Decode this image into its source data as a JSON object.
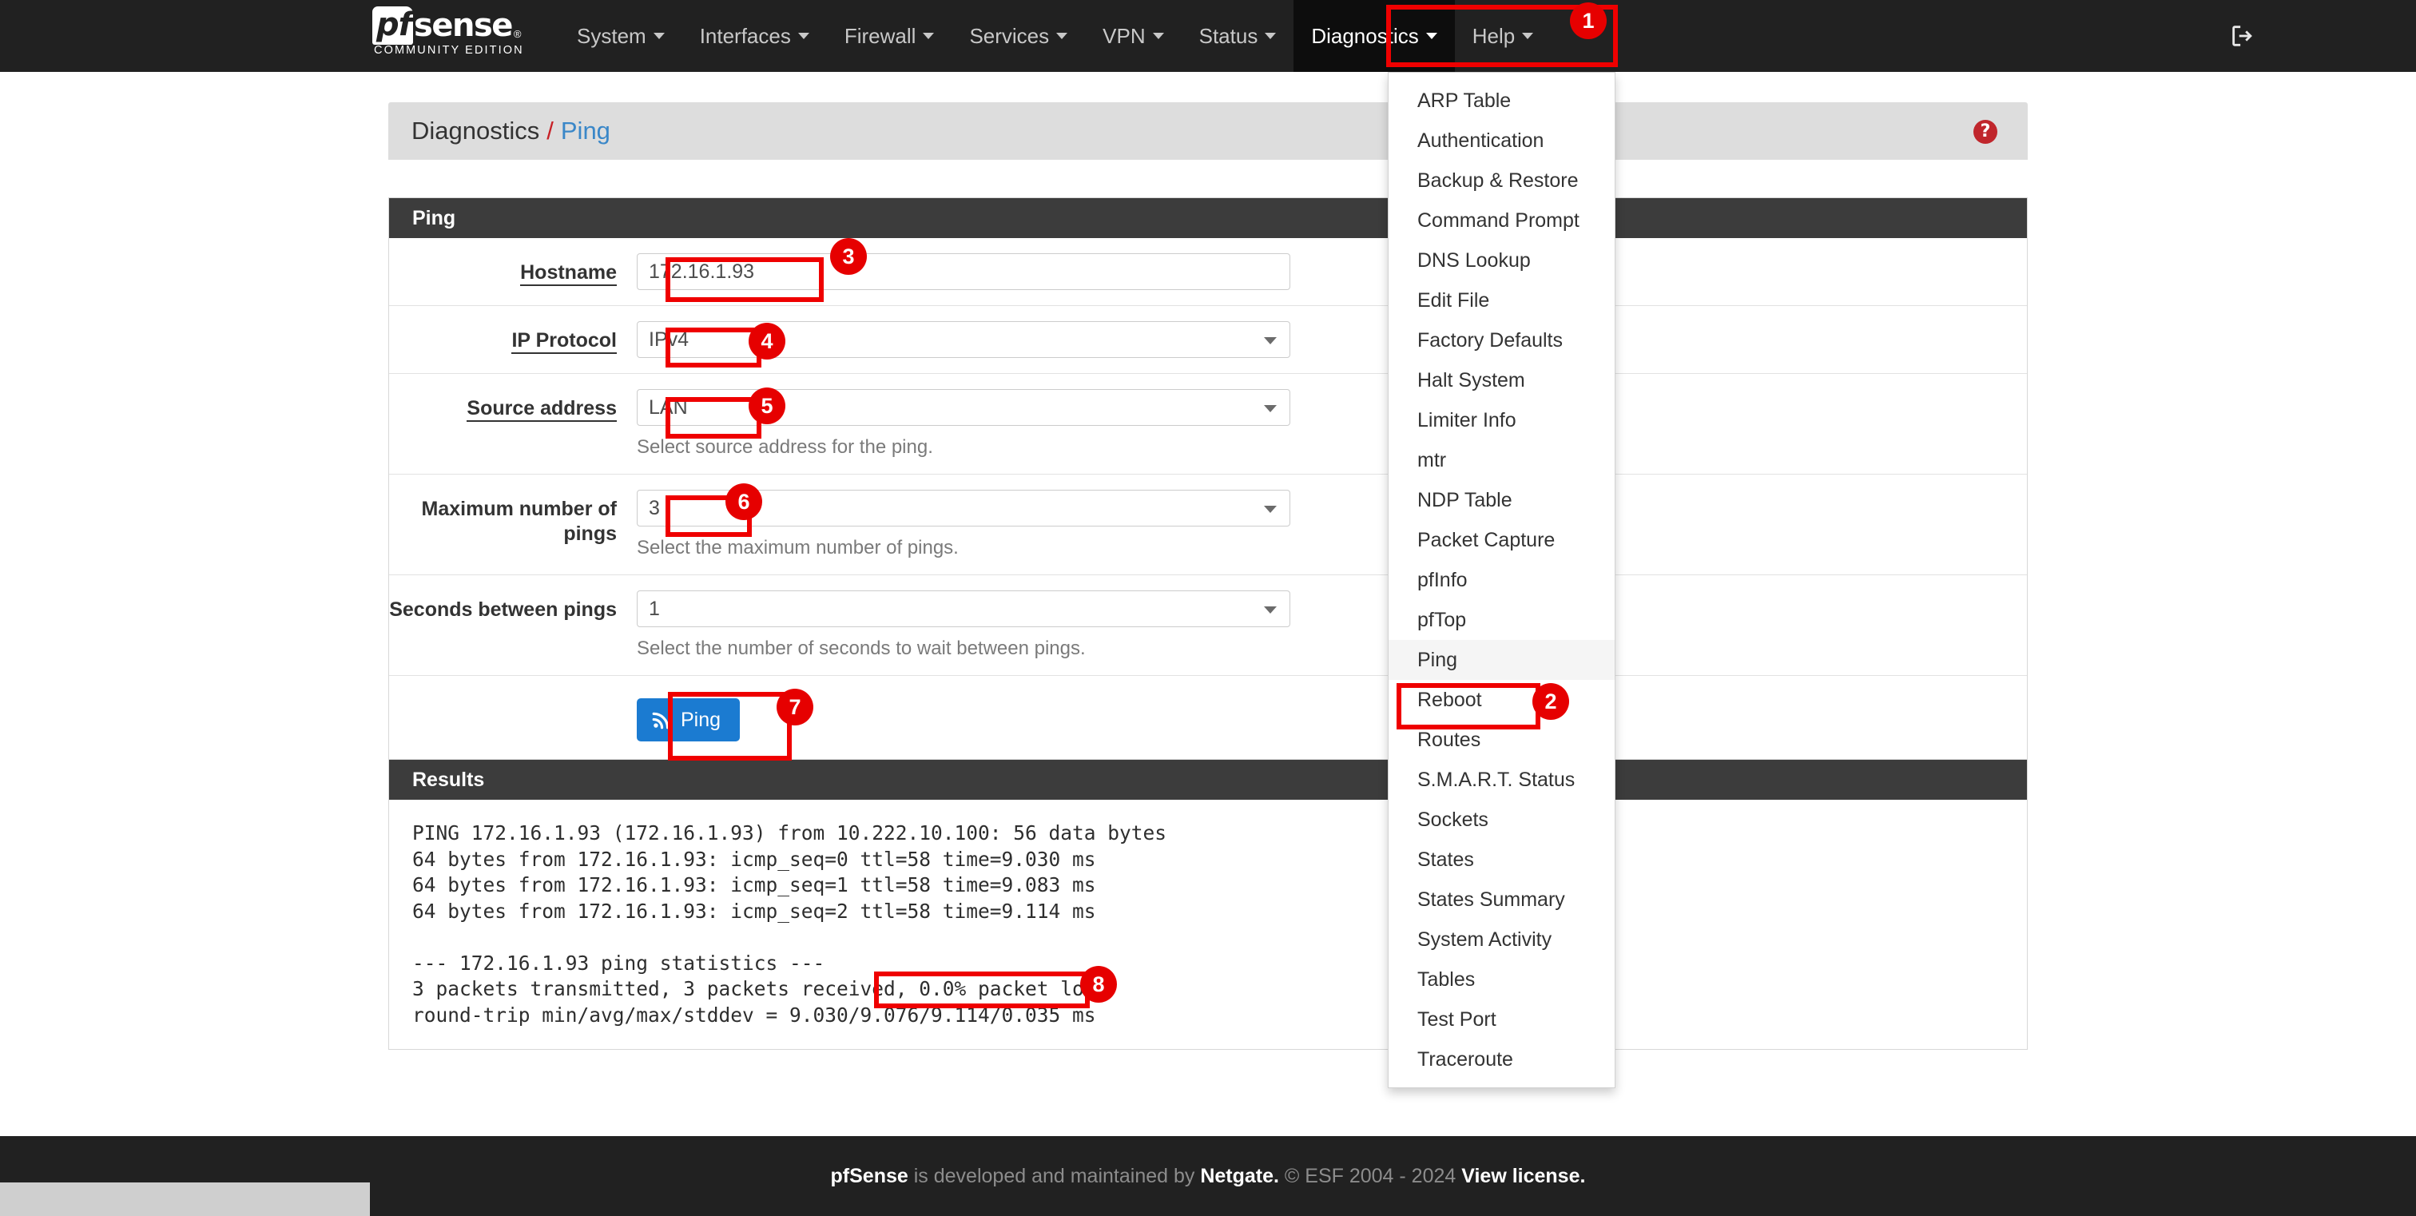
{
  "brand": {
    "pf": "pf",
    "sense": "sense",
    "reg": "®",
    "subtitle": "COMMUNITY EDITION"
  },
  "navbar": {
    "items": [
      {
        "label": "System"
      },
      {
        "label": "Interfaces"
      },
      {
        "label": "Firewall"
      },
      {
        "label": "Services"
      },
      {
        "label": "VPN"
      },
      {
        "label": "Status"
      },
      {
        "label": "Diagnostics"
      },
      {
        "label": "Help"
      }
    ],
    "logout_icon": "logout-icon"
  },
  "dropdown": {
    "items": [
      {
        "label": "ARP Table"
      },
      {
        "label": "Authentication"
      },
      {
        "label": "Backup & Restore"
      },
      {
        "label": "Command Prompt"
      },
      {
        "label": "DNS Lookup"
      },
      {
        "label": "Edit File"
      },
      {
        "label": "Factory Defaults"
      },
      {
        "label": "Halt System"
      },
      {
        "label": "Limiter Info"
      },
      {
        "label": "mtr"
      },
      {
        "label": "NDP Table"
      },
      {
        "label": "Packet Capture"
      },
      {
        "label": "pfInfo"
      },
      {
        "label": "pfTop"
      },
      {
        "label": "Ping"
      },
      {
        "label": "Reboot"
      },
      {
        "label": "Routes"
      },
      {
        "label": "S.M.A.R.T. Status"
      },
      {
        "label": "Sockets"
      },
      {
        "label": "States"
      },
      {
        "label": "States Summary"
      },
      {
        "label": "System Activity"
      },
      {
        "label": "Tables"
      },
      {
        "label": "Test Port"
      },
      {
        "label": "Traceroute"
      }
    ]
  },
  "breadcrumb": {
    "parent": "Diagnostics",
    "separator": "/",
    "current": "Ping",
    "help_icon": "?"
  },
  "ping_panel": {
    "title": "Ping",
    "hostname": {
      "label": "Hostname",
      "value": "172.16.1.93"
    },
    "ip_protocol": {
      "label": "IP Protocol",
      "value": "IPv4"
    },
    "source_address": {
      "label": "Source address",
      "value": "LAN",
      "help": "Select source address for the ping."
    },
    "max_pings": {
      "label": "Maximum number of pings",
      "value": "3",
      "help": "Select the maximum number of pings."
    },
    "seconds_between": {
      "label": "Seconds between pings",
      "value": "1",
      "help": "Select the number of seconds to wait between pings."
    },
    "submit": {
      "label": "Ping",
      "icon": "signal-icon"
    }
  },
  "results_panel": {
    "title": "Results",
    "lines": [
      "PING 172.16.1.93 (172.16.1.93) from 10.222.10.100: 56 data bytes",
      "64 bytes from 172.16.1.93: icmp_seq=0 ttl=58 time=9.030 ms",
      "64 bytes from 172.16.1.93: icmp_seq=1 ttl=58 time=9.083 ms",
      "64 bytes from 172.16.1.93: icmp_seq=2 ttl=58 time=9.114 ms",
      "",
      "--- 172.16.1.93 ping statistics ---",
      "3 packets transmitted, 3 packets received, 0.0% packet loss",
      "round-trip min/avg/max/stddev = 9.030/9.076/9.114/0.035 ms"
    ],
    "highlight_text": "0.0% packet loss"
  },
  "footer": {
    "brand": "pfSense",
    "mid": " is developed and maintained by ",
    "netgate": "Netgate.",
    "copyright": " © ESF 2004 - 2024 ",
    "license": "View license."
  },
  "annotations": {
    "badges": [
      "1",
      "2",
      "3",
      "4",
      "5",
      "6",
      "7",
      "8"
    ]
  },
  "colors": {
    "navbar_bg": "#212121",
    "accent_red": "#e60000",
    "link_blue": "#3a87c8",
    "button_blue": "#1b7bd1",
    "panel_head": "#3c3c3c"
  }
}
